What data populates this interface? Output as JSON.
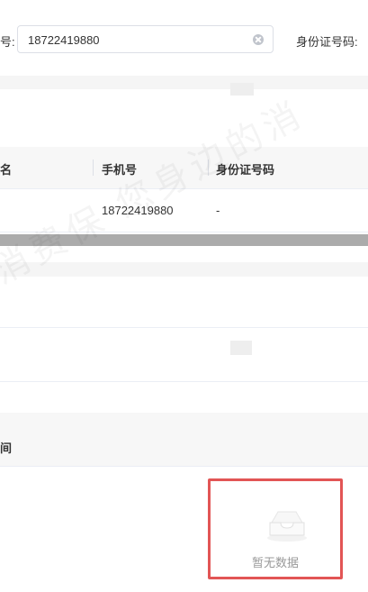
{
  "filters": {
    "phone_label_fragment": "号:",
    "phone_value": "18722419880",
    "id_label": "身份证号码:"
  },
  "table": {
    "columns": [
      "名",
      "手机号",
      "身份证号码"
    ],
    "rows": [
      {
        "name": "",
        "phone": "18722419880",
        "id_number": "-"
      }
    ]
  },
  "second_table": {
    "header_fragment": "间"
  },
  "empty_state": {
    "text": "暂无数据",
    "icon": "empty-tray-icon"
  },
  "watermark": {
    "text": "消费保 您身边的消"
  },
  "colors": {
    "highlight_border": "#e25555",
    "scrollbar": "#ababab"
  }
}
